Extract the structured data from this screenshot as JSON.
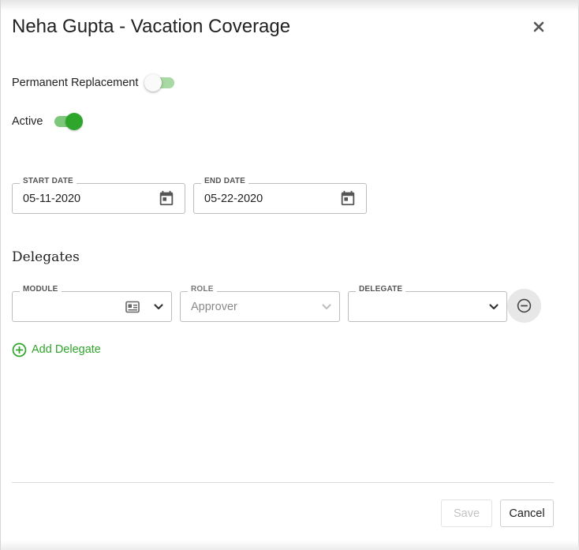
{
  "dialog": {
    "title": "Neha Gupta - Vacation Coverage",
    "close_icon": "close-icon"
  },
  "permanent_replacement": {
    "label": "Permanent Replacement",
    "enabled": false
  },
  "active": {
    "label": "Active",
    "enabled": true
  },
  "start_date": {
    "label": "START DATE",
    "value": "05-11-2020",
    "icon": "calendar-icon"
  },
  "end_date": {
    "label": "END DATE",
    "value": "05-22-2020",
    "icon": "calendar-icon"
  },
  "delegates": {
    "title": "Delegates",
    "module": {
      "label": "MODULE",
      "value": "",
      "icon": "id-card-icon"
    },
    "role": {
      "label": "ROLE",
      "value": "Approver"
    },
    "delegate": {
      "label": "DELEGATE",
      "value": ""
    },
    "remove_icon": "remove-circle-icon",
    "add_label": "Add Delegate"
  },
  "footer": {
    "save_label": "Save",
    "cancel_label": "Cancel"
  },
  "colors": {
    "accent": "#2ea62b",
    "accent_light": "#7dc77a",
    "border": "#bdbdbd",
    "disabled_text": "#c3c3c3"
  }
}
